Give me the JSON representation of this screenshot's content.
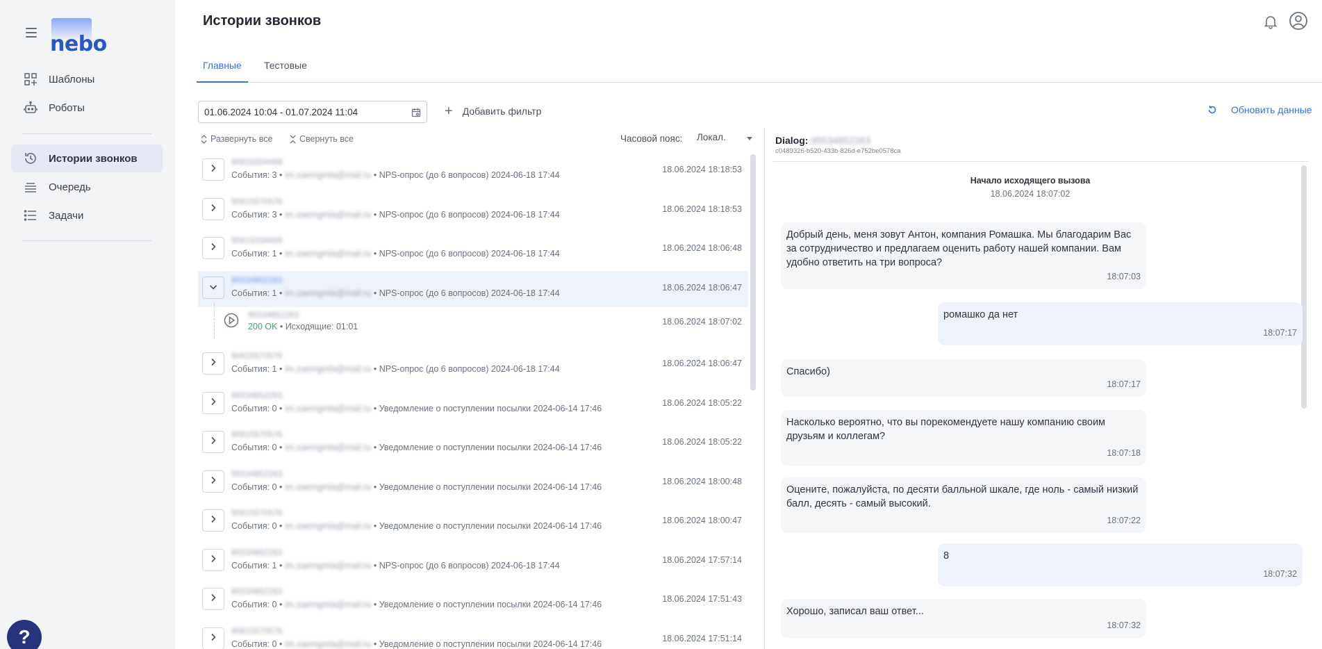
{
  "app": {
    "title": "Истории звонков",
    "logo_text": "nebo",
    "help_label": "?"
  },
  "sidebar": {
    "items": [
      {
        "label": "Шаблоны",
        "icon": "templates-icon"
      },
      {
        "label": "Роботы",
        "icon": "robot-icon"
      },
      {
        "label": "Истории звонков",
        "icon": "history-icon",
        "active": true
      },
      {
        "label": "Очередь",
        "icon": "queue-icon"
      },
      {
        "label": "Задачи",
        "icon": "tasks-icon"
      }
    ]
  },
  "tabs": [
    {
      "label": "Главные",
      "active": true
    },
    {
      "label": "Тестовые",
      "active": false
    }
  ],
  "filters": {
    "date_range": "01.06.2024 10:04 - 01.07.2024 11:04",
    "add_filter": "Добавить фильтр",
    "refresh": "Обновить данные",
    "expand_all": "Развернуть все",
    "collapse_all": "Свернуть все",
    "timezone_label": "Часовой пояс:",
    "timezone_value": "Локал."
  },
  "calls": [
    {
      "number": "90815334469",
      "events": "События: 3",
      "email": "im.zaemgmla@mail.ru",
      "campaign": "NPS-опрос (до 6 вопросов) 2024-06-18 17:44",
      "time": "18.06.2024 18:18:53"
    },
    {
      "number": "90815570576",
      "events": "События: 3",
      "email": "im.zaemgmla@mail.ru",
      "campaign": "NPS-опрос (до 6 вопросов) 2024-06-18 17:44",
      "time": "18.06.2024 18:18:53"
    },
    {
      "number": "90815334469",
      "events": "События: 1",
      "email": "im.zaemgmla@mail.ru",
      "campaign": "NPS-опрос (до 6 вопросов) 2024-06-18 17:44",
      "time": "18.06.2024 18:06:48"
    },
    {
      "number": "95534852263",
      "events": "События: 1",
      "email": "im.zaemgmla@mail.ru",
      "campaign": "NPS-опрос (до 6 вопросов) 2024-06-18 17:44",
      "time": "18.06.2024 18:06:47",
      "expanded": true
    },
    {
      "number": "90815570576",
      "events": "События: 1",
      "email": "im.zaemgmla@mail.ru",
      "campaign": "NPS-опрос (до 6 вопросов) 2024-06-18 17:44",
      "time": "18.06.2024 18:06:47"
    },
    {
      "number": "95534852263",
      "events": "События: 0",
      "email": "im.zaemgmla@mail.ru",
      "campaign": "Уведомление о поступлении посылки 2024-06-14 17:46",
      "time": "18.06.2024 18:05:22"
    },
    {
      "number": "90815570576",
      "events": "События: 0",
      "email": "im.zaemgmla@mail.ru",
      "campaign": "Уведомление о поступлении посылки 2024-06-14 17:46",
      "time": "18.06.2024 18:05:22"
    },
    {
      "number": "95534852263",
      "events": "События: 0",
      "email": "im.zaemgmla@mail.ru",
      "campaign": "Уведомление о поступлении посылки 2024-06-14 17:46",
      "time": "18.06.2024 18:00:48"
    },
    {
      "number": "90815570576",
      "events": "События: 0",
      "email": "im.zaemgmla@mail.ru",
      "campaign": "Уведомление о поступлении посылки 2024-06-14 17:46",
      "time": "18.06.2024 18:00:47"
    },
    {
      "number": "95534852263",
      "events": "События: 1",
      "email": "im.zaemgmla@mail.ru",
      "campaign": "NPS-опрос (до 6 вопросов) 2024-06-18 17:44",
      "time": "18.06.2024 17:57:14"
    },
    {
      "number": "95534852263",
      "events": "События: 0",
      "email": "im.zaemgmla@mail.ru",
      "campaign": "Уведомление о поступлении посылки 2024-06-14 17:46",
      "time": "18.06.2024 17:51:43"
    },
    {
      "number": "90815570576",
      "events": "События: 0",
      "email": "im.zaemgmla@mail.ru",
      "campaign": "Уведомление о поступлении посылки 2024-06-14 17:46",
      "time": "18.06.2024 17:51:14"
    }
  ],
  "expanded_event": {
    "number": "95534852263",
    "status": "200 OK",
    "details": "Исходящие: 01:01",
    "time": "18.06.2024 18:07:02"
  },
  "dialog": {
    "title_prefix": "Dialog:",
    "number": "95534852263",
    "id": "c0489326-b520-433b-826d-e752be0578ca",
    "start_title": "Начало исходящего вызова",
    "start_time": "18.06.2024 18:07:02",
    "messages": [
      {
        "role": "bot",
        "text": "Добрый день, меня зовут Антон, компания Ромашка. Мы благодарим Вас за сотрудничество и предлагаем оценить работу нашей компании. Вам удобно ответить на три вопроса?",
        "time": "18:07:03"
      },
      {
        "role": "user",
        "text": "ромашко да нет",
        "time": "18:07:17"
      },
      {
        "role": "bot",
        "text": "Спасибо)",
        "time": "18:07:17"
      },
      {
        "role": "bot",
        "text": "Насколько вероятно, что вы порекомендуете нашу компанию своим друзьям и коллегам?",
        "time": "18:07:18"
      },
      {
        "role": "bot",
        "text": "Оцените, пожалуйста, по десяти балльной шкале, где ноль - самый низкий балл, десять - самый высокий.",
        "time": "18:07:22"
      },
      {
        "role": "user",
        "text": "8",
        "time": "18:07:32"
      },
      {
        "role": "bot",
        "text": "Хорошо, записал ваш ответ...",
        "time": "18:07:32"
      }
    ]
  },
  "colors": {
    "accent": "#3b6ed9",
    "sidebar_bg": "#f3f4f6",
    "status_ok": "#3fa964",
    "help_bg": "#28337d"
  }
}
